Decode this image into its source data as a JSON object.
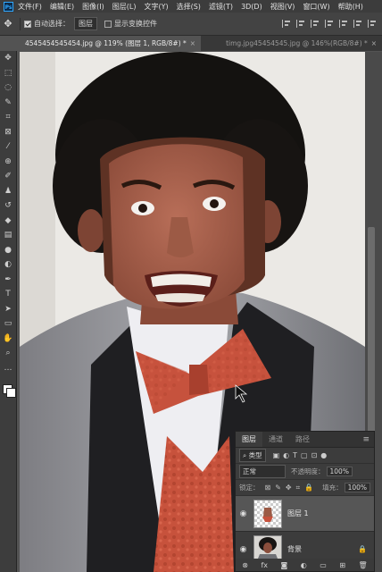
{
  "menubar": {
    "logo": "Ps",
    "items": [
      "文件(F)",
      "编辑(E)",
      "图像(I)",
      "图层(L)",
      "文字(Y)",
      "选择(S)",
      "滤镜(T)",
      "3D(D)",
      "视图(V)",
      "窗口(W)",
      "帮助(H)"
    ]
  },
  "options": {
    "auto_select_label": "自动选择：",
    "auto_select_value": "图层",
    "transform_label": "显示变换控件"
  },
  "tabs": [
    {
      "label": "4545454545454.jpg @ 119% (图层 1, RGB/8#) *",
      "close": "×"
    },
    {
      "label": "timg.jpg45454545.jpg @ 146%(RGB/8#) *",
      "close": "×"
    }
  ],
  "layers_panel": {
    "tabs": [
      "图层",
      "通道",
      "路径"
    ],
    "menu_icon": "≡",
    "filter_kind": "⌕ 类型",
    "blend_mode": "正常",
    "opacity_label": "不透明度：",
    "opacity_value": "100%",
    "lock_label": "锁定：",
    "fill_label": "填充：",
    "fill_value": "100%",
    "layers": [
      {
        "name": "图层 1",
        "selected": true
      },
      {
        "name": "背景",
        "selected": false
      }
    ]
  },
  "colors": {
    "accent": "#31a8ff",
    "panel": "#3c3c3c",
    "workspace": "#535353"
  }
}
